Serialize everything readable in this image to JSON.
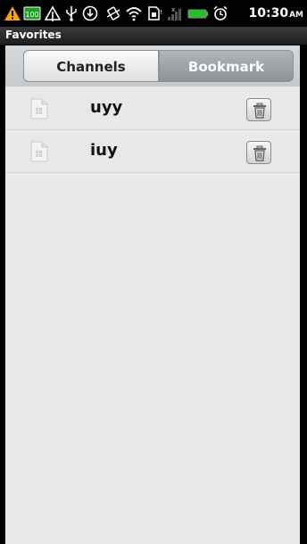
{
  "status_bar": {
    "time": "10:30",
    "ampm": "AM",
    "battery_badge": "100",
    "icons": [
      "warning-icon",
      "battery-100-badge-icon",
      "usb-debug-icon",
      "usb-icon",
      "download-icon",
      "vibrate-icon",
      "wifi-icon",
      "sim-icon",
      "signal-icon",
      "battery-icon",
      "alarm-icon"
    ]
  },
  "title_bar": {
    "title": "Favorites"
  },
  "tabs": [
    {
      "label": "Channels",
      "selected": false
    },
    {
      "label": "Bookmark",
      "selected": true
    }
  ],
  "bookmarks": [
    {
      "label": "uyy",
      "icon": "file-icon",
      "action_icon": "trash-icon"
    },
    {
      "label": "iuy",
      "icon": "file-icon",
      "action_icon": "trash-icon"
    }
  ],
  "colors": {
    "background": "#e6e8ea",
    "selected_tab": "#8e9296",
    "warning": "#f7a400",
    "battery_green": "#22c222"
  }
}
